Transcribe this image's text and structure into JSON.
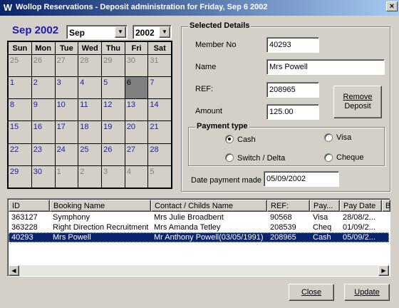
{
  "window": {
    "app_icon": "W",
    "title": "Wollop Reservations - Deposit administration for Friday, Sep 6 2002",
    "close_label": "×"
  },
  "calendar": {
    "heading": "Sep 2002",
    "month_select": "Sep",
    "year_select": "2002",
    "weekdays": [
      "Sun",
      "Mon",
      "Tue",
      "Wed",
      "Thu",
      "Fri",
      "Sat"
    ],
    "weeks": [
      [
        "25",
        "26",
        "27",
        "28",
        "29",
        "30",
        "31"
      ],
      [
        "1",
        "2",
        "3",
        "4",
        "5",
        "6",
        "7"
      ],
      [
        "8",
        "9",
        "10",
        "11",
        "12",
        "13",
        "14"
      ],
      [
        "15",
        "16",
        "17",
        "18",
        "19",
        "20",
        "21"
      ],
      [
        "22",
        "23",
        "24",
        "25",
        "26",
        "27",
        "28"
      ],
      [
        "29",
        "30",
        "1",
        "2",
        "3",
        "4",
        "5"
      ]
    ],
    "selected_day": "6"
  },
  "details": {
    "legend": "Selected Details",
    "member_no_label": "Member No",
    "member_no": "40293",
    "name_label": "Name",
    "name": "Mrs  Powell",
    "ref_label": "REF:",
    "ref": "208965",
    "amount_label": "Amount",
    "amount": "125.00",
    "remove_deposit_line1": "Remove",
    "remove_deposit_line2": "Deposit",
    "payment_type_legend": "Payment type",
    "payment_types": [
      "Cash",
      "Visa",
      "Switch / Delta",
      "Cheque"
    ],
    "payment_selected": "Cash",
    "date_label": "Date payment made",
    "date_value": "05/09/2002"
  },
  "grid": {
    "columns": [
      "ID",
      "Booking Name",
      "Contact / Childs Name",
      "REF:",
      "Pay...",
      "Pay Date",
      "B"
    ],
    "rows": [
      [
        "363127",
        "Symphony",
        "Mrs Julie Broadbent",
        "90568",
        "Visa",
        "28/08/2..."
      ],
      [
        "363228",
        "Right Direction Recruitment",
        "Mrs Amanda  Tetley",
        "208539",
        "Cheq",
        "01/09/2..."
      ],
      [
        "40293",
        "Mrs  Powell",
        "Mr Anthony Powell(03/05/1991)",
        "208965",
        "Cash",
        "05/09/2..."
      ]
    ],
    "selected_row": 2
  },
  "buttons": {
    "close": "Close",
    "update": "Update"
  }
}
